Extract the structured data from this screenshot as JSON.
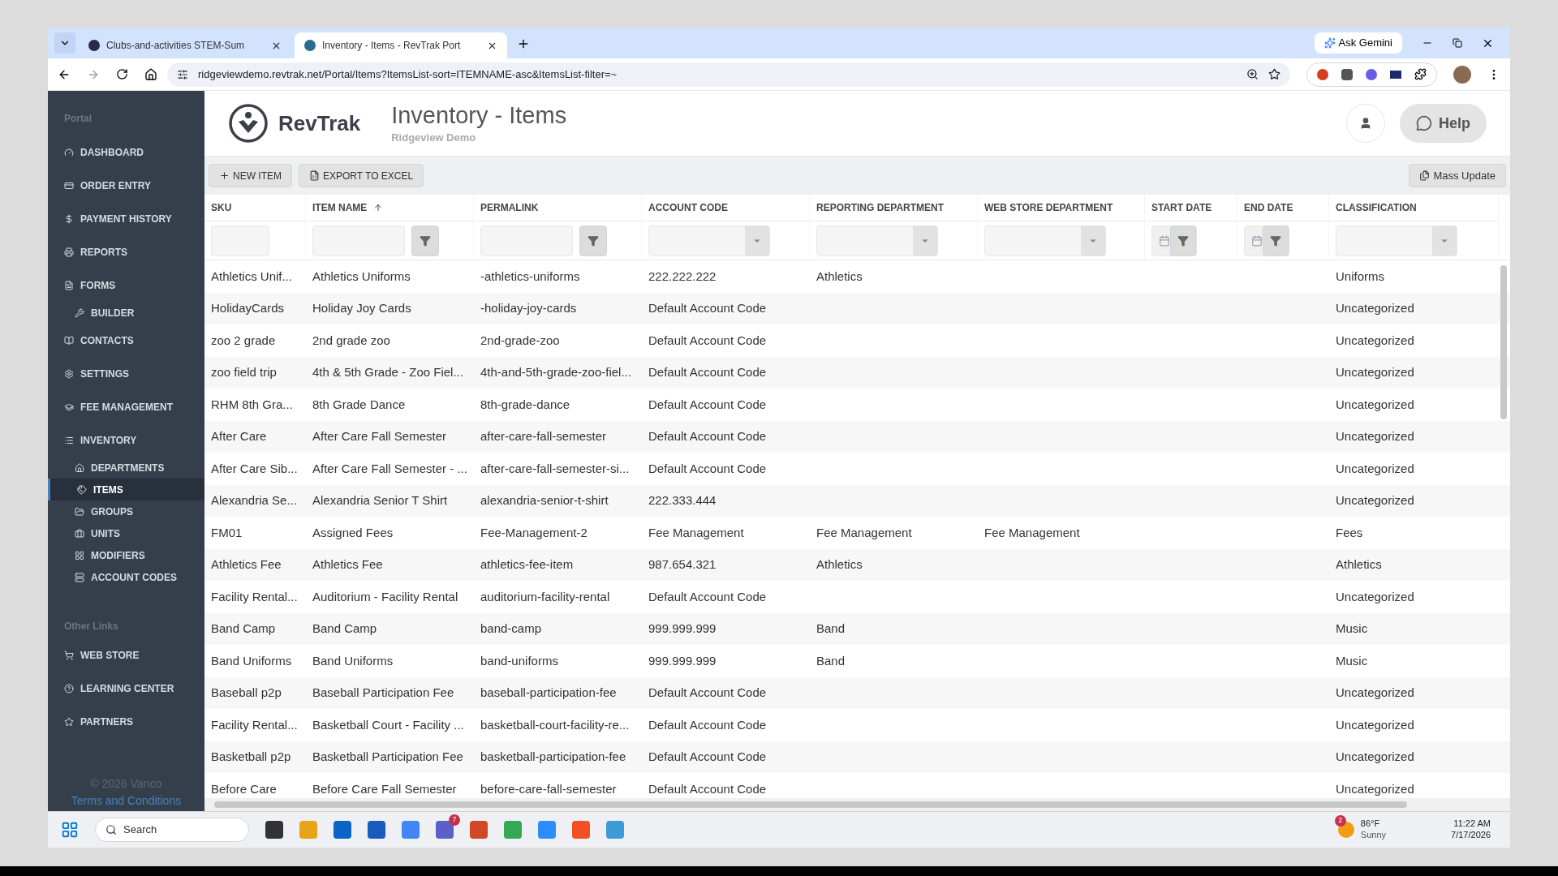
{
  "browser": {
    "tabs": [
      {
        "title": "Clubs-and-activities STEM-Sum",
        "selected": false
      },
      {
        "title": "Inventory - Items - RevTrak Port",
        "selected": true
      }
    ],
    "address": "ridgeviewdemo.revtrak.net/Portal/Items?ItemsList-sort=ITEMNAME-asc&ItemsList-filter=~",
    "gemini": "Ask Gemini"
  },
  "sidebar": {
    "section": "Portal",
    "items": [
      {
        "label": "DASHBOARD",
        "kind": "top",
        "selected": false
      },
      {
        "label": "ORDER ENTRY",
        "kind": "top",
        "selected": false
      },
      {
        "label": "PAYMENT HISTORY",
        "kind": "top",
        "selected": false
      },
      {
        "label": "REPORTS",
        "kind": "top",
        "selected": false
      },
      {
        "label": "FORMS",
        "kind": "top",
        "selected": false
      },
      {
        "label": "BUILDER",
        "kind": "sub",
        "selected": false
      },
      {
        "label": "CONTACTS",
        "kind": "top",
        "selected": false
      },
      {
        "label": "SETTINGS",
        "kind": "top",
        "selected": false
      },
      {
        "label": "FEE MANAGEMENT",
        "kind": "top",
        "selected": false
      },
      {
        "label": "INVENTORY",
        "kind": "top",
        "selected": false
      },
      {
        "label": "DEPARTMENTS",
        "kind": "sub",
        "selected": false
      },
      {
        "label": "ITEMS",
        "kind": "sub",
        "selected": true
      },
      {
        "label": "GROUPS",
        "kind": "sub",
        "selected": false
      },
      {
        "label": "UNITS",
        "kind": "sub",
        "selected": false
      },
      {
        "label": "MODIFIERS",
        "kind": "sub",
        "selected": false
      },
      {
        "label": "ACCOUNT CODES",
        "kind": "sub",
        "selected": false
      }
    ],
    "other_section": "Other Links",
    "other_items": [
      {
        "label": "WEB STORE"
      },
      {
        "label": "LEARNING CENTER"
      },
      {
        "label": "PARTNERS"
      }
    ],
    "copyright": "© 2026 Vanco",
    "terms": "Terms and Conditions"
  },
  "header": {
    "brand": "RevTrak",
    "title": "Inventory - Items",
    "subtitle": "Ridgeview Demo",
    "help": "Help"
  },
  "toolbar": {
    "new_item": "NEW ITEM",
    "export": "EXPORT TO EXCEL",
    "mass_update": "Mass Update"
  },
  "table": {
    "columns": [
      {
        "label": "SKU",
        "kind": "text",
        "sorted": false
      },
      {
        "label": "ITEM NAME",
        "kind": "text-button",
        "sorted": true
      },
      {
        "label": "PERMALINK",
        "kind": "text-button",
        "sorted": false
      },
      {
        "label": "ACCOUNT CODE",
        "kind": "select",
        "sorted": false
      },
      {
        "label": "REPORTING DEPARTMENT",
        "kind": "select",
        "sorted": false
      },
      {
        "label": "WEB STORE DEPARTMENT",
        "kind": "select",
        "sorted": false
      },
      {
        "label": "START DATE",
        "kind": "date",
        "sorted": false
      },
      {
        "label": "END DATE",
        "kind": "date",
        "sorted": false
      },
      {
        "label": "CLASSIFICATION",
        "kind": "select",
        "sorted": false
      }
    ],
    "rows": [
      [
        "Athletics Unif...",
        "Athletics Uniforms",
        "-athletics-uniforms",
        "222.222.222",
        "Athletics",
        "",
        "",
        "",
        "Uniforms"
      ],
      [
        "HolidayCards",
        "Holiday Joy Cards",
        "-holiday-joy-cards",
        "Default Account Code",
        "",
        "",
        "",
        "",
        "Uncategorized"
      ],
      [
        "zoo 2 grade",
        "2nd grade zoo",
        "2nd-grade-zoo",
        "Default Account Code",
        "",
        "",
        "",
        "",
        "Uncategorized"
      ],
      [
        "zoo field trip",
        "4th & 5th Grade - Zoo Fiel...",
        "4th-and-5th-grade-zoo-fiel...",
        "Default Account Code",
        "",
        "",
        "",
        "",
        "Uncategorized"
      ],
      [
        "RHM 8th Gra...",
        "8th Grade Dance",
        "8th-grade-dance",
        "Default Account Code",
        "",
        "",
        "",
        "",
        "Uncategorized"
      ],
      [
        "After Care",
        "After Care Fall Semester",
        "after-care-fall-semester",
        "Default Account Code",
        "",
        "",
        "",
        "",
        "Uncategorized"
      ],
      [
        "After Care Sib...",
        "After Care Fall Semester - ...",
        "after-care-fall-semester-si...",
        "Default Account Code",
        "",
        "",
        "",
        "",
        "Uncategorized"
      ],
      [
        "Alexandria Se...",
        "Alexandria Senior T Shirt",
        "alexandria-senior-t-shirt",
        "222.333.444",
        "",
        "",
        "",
        "",
        "Uncategorized"
      ],
      [
        "FM01",
        "Assigned Fees",
        "Fee-Management-2",
        "Fee Management",
        "Fee Management",
        "Fee Management",
        "",
        "",
        "Fees"
      ],
      [
        "Athletics Fee",
        "Athletics Fee",
        "athletics-fee-item",
        "987.654.321",
        "Athletics",
        "",
        "",
        "",
        "Athletics"
      ],
      [
        "Facility Rental...",
        "Auditorium - Facility Rental",
        "auditorium-facility-rental",
        "Default Account Code",
        "",
        "",
        "",
        "",
        "Uncategorized"
      ],
      [
        "Band Camp",
        "Band Camp",
        "band-camp",
        "999.999.999",
        "Band",
        "",
        "",
        "",
        "Music"
      ],
      [
        "Band Uniforms",
        "Band Uniforms",
        "band-uniforms",
        "999.999.999",
        "Band",
        "",
        "",
        "",
        "Music"
      ],
      [
        "Baseball p2p",
        "Baseball Participation Fee",
        "baseball-participation-fee",
        "Default Account Code",
        "",
        "",
        "",
        "",
        "Uncategorized"
      ],
      [
        "Facility Rental...",
        "Basketball Court - Facility ...",
        "basketball-court-facility-re...",
        "Default Account Code",
        "",
        "",
        "",
        "",
        "Uncategorized"
      ],
      [
        "Basketball p2p",
        "Basketball Participation Fee",
        "basketball-participation-fee",
        "Default Account Code",
        "",
        "",
        "",
        "",
        "Uncategorized"
      ],
      [
        "Before Care",
        "Before Care Fall Semester",
        "before-care-fall-semester",
        "Default Account Code",
        "",
        "",
        "",
        "",
        "Uncategorized"
      ]
    ]
  },
  "taskbar": {
    "search": "Search",
    "teams_badge": "7",
    "weather_badge": "2",
    "temperature": "86°F",
    "condition": "Sunny",
    "time": "11:22 AM",
    "date": "7/17/2026"
  }
}
